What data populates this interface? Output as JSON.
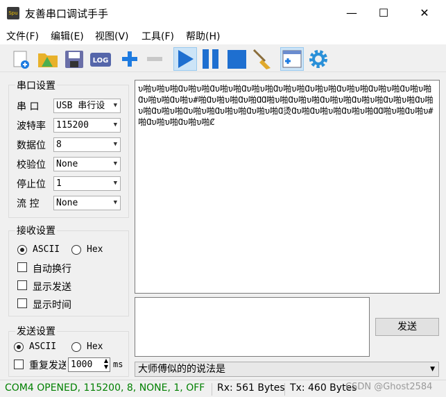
{
  "window": {
    "title": "友善串口调试手手",
    "app_icon_text": "Spu",
    "minimize": "—",
    "maximize": "☐",
    "close": "✕"
  },
  "menu": [
    "文件(F)",
    "编辑(E)",
    "视图(V)",
    "工具(F)",
    "帮助(H)"
  ],
  "toolbar": {
    "icons": [
      "new-file-icon",
      "open-folder-icon",
      "save-icon",
      "log-icon",
      "plus-icon",
      "minus-icon",
      "play-icon",
      "pause-icon",
      "stop-icon",
      "broom-icon",
      "window-icon",
      "gear-icon"
    ],
    "log_text": "LOG"
  },
  "serial_settings": {
    "title": "串口设置",
    "fields": [
      {
        "label": "串  口",
        "value": "USB 串行设"
      },
      {
        "label": "波特率",
        "value": "115200"
      },
      {
        "label": "数据位",
        "value": "8"
      },
      {
        "label": "校验位",
        "value": "None"
      },
      {
        "label": "停止位",
        "value": "1"
      },
      {
        "label": "流  控",
        "value": "None"
      }
    ]
  },
  "receive_settings": {
    "title": "接收设置",
    "ascii": "ASCII",
    "hex": "Hex",
    "checks": [
      "自动换行",
      "显示发送",
      "显示时间"
    ]
  },
  "send_settings": {
    "title": "发送设置",
    "ascii": "ASCII",
    "hex": "Hex",
    "repeat": "重复发送",
    "interval": "1000",
    "unit": "ms"
  },
  "receive_text": "υ啪υ啪υ啪Ɑυ啪υ啪Ɑυ啪υ啪Ɑυ啪υ啪Ɑυ啪υ啪Ɑυ啪υ啪Ɑυ啪υ啪Ɑυ啪υ啪Ɑυ啪υ啪Ɑυ啪υ啪Ɑυ啪υ#啪Ɑυ啪υ啪Ɑυ啪ⱭⱭ啪υ啪Ɑυ啪υ啪Ɑυ啪υ啪Ɑυ啪υ啪Ɑυ啪υ啪Ɑυ啪υ啪Ɑυ啪υ啪Ɑυ啪υ啪Ɑυ啪υ啪Ɑυ啪υ啪Ɑ烫Ɑυ啪Ɑυ啪υ啪Ɑυ啪υ啪ⱭⱭ啪υ啪Ɑυ啪υ#啪Ɑυ啪υ啪Ɑυ啪υ啪Ȼ",
  "send_button": "发送",
  "history": "大师傅似的的说法是",
  "status": {
    "port": "COM4 OPENED, 115200, 8, NONE, 1, OFF",
    "port_color": "#008000",
    "rx": "Rx: 561 Bytes",
    "tx": "Tx: 460 Bytes",
    "watermark": "CSDN @Ghost2584"
  }
}
